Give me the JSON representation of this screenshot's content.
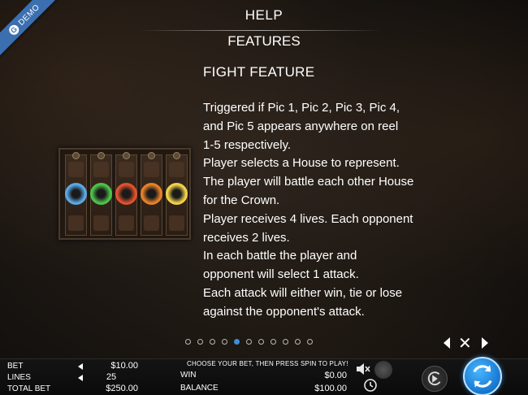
{
  "demo_ribbon": {
    "label": "DEMO",
    "logo": "G"
  },
  "header": {
    "title": "HELP",
    "subtitle": "FEATURES"
  },
  "section": {
    "title": "FIGHT FEATURE",
    "lines": [
      "Triggered if Pic 1, Pic 2, Pic 3, Pic 4,",
      "and Pic 5 appears anywhere on reel",
      "1-5 respectively.",
      "Player selects a House to represent.",
      "The player will battle each other House",
      "for the Crown.",
      "Player receives 4 lives. Each opponent",
      "receives 2 lives.",
      "In each battle the player and",
      "opponent will select 1 attack.",
      "Each attack will either win, tie or lose",
      "against the opponent's attack."
    ]
  },
  "reel_preview": {
    "crest_colors": [
      "#5aa9e6",
      "#4ec24a",
      "#e0522e",
      "#e8802a",
      "#f2d24a"
    ]
  },
  "pager": {
    "total": 11,
    "active_index": 4
  },
  "nav": {
    "prev_icon": "arrow-left-icon",
    "close_icon": "close-icon",
    "next_icon": "arrow-right-icon",
    "close_glyph": "✕"
  },
  "bottom_bar": {
    "message": "CHOOSE YOUR BET, THEN PRESS SPIN TO PLAY!",
    "bet_label": "BET",
    "bet_value": "$10.00",
    "lines_label": "LINES",
    "lines_value": "25",
    "total_bet_label": "TOTAL BET",
    "total_bet_value": "$250.00",
    "win_label": "WIN",
    "win_value": "$0.00",
    "balance_label": "BALANCE",
    "balance_value": "$100.00"
  },
  "colors": {
    "accent": "#3d8fd6",
    "spin": "#1c7fd6",
    "ribbon": "#3b6fb0"
  }
}
